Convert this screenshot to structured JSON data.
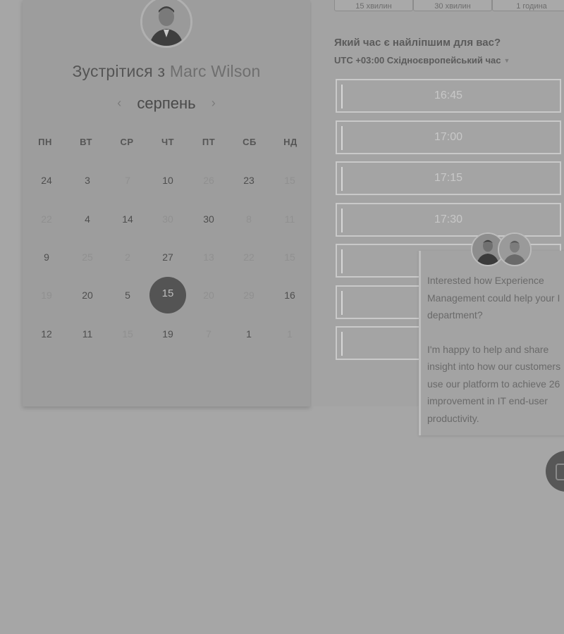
{
  "booking": {
    "title_prefix": "Зустрітися з",
    "host_name": "Marc Wilson",
    "month": "серпень",
    "prev_icon": "chevron-left-icon",
    "next_icon": "chevron-right-icon",
    "weekdays": [
      "ПН",
      "ВТ",
      "СР",
      "ЧТ",
      "ПТ",
      "СБ",
      "НД"
    ],
    "weeks": [
      [
        {
          "d": "24",
          "a": true
        },
        {
          "d": "3",
          "a": true
        },
        {
          "d": "7",
          "a": false
        },
        {
          "d": "10",
          "a": true
        },
        {
          "d": "26",
          "a": false
        },
        {
          "d": "23",
          "a": true
        },
        {
          "d": "15",
          "a": false
        }
      ],
      [
        {
          "d": "22",
          "a": false
        },
        {
          "d": "4",
          "a": true
        },
        {
          "d": "14",
          "a": true
        },
        {
          "d": "30",
          "a": false
        },
        {
          "d": "30",
          "a": true
        },
        {
          "d": "8",
          "a": false
        },
        {
          "d": "11",
          "a": false
        }
      ],
      [
        {
          "d": "9",
          "a": true
        },
        {
          "d": "25",
          "a": false
        },
        {
          "d": "2",
          "a": false
        },
        {
          "d": "27",
          "a": true
        },
        {
          "d": "13",
          "a": false
        },
        {
          "d": "22",
          "a": false
        },
        {
          "d": "15",
          "a": false
        }
      ],
      [
        {
          "d": "19",
          "a": false
        },
        {
          "d": "20",
          "a": true
        },
        {
          "d": "5",
          "a": true
        },
        {
          "d": "15",
          "a": true,
          "selected": true
        },
        {
          "d": "20",
          "a": false
        },
        {
          "d": "29",
          "a": false
        },
        {
          "d": "16",
          "a": true
        }
      ],
      [
        {
          "d": "12",
          "a": true
        },
        {
          "d": "11",
          "a": true
        },
        {
          "d": "15",
          "a": false
        },
        {
          "d": "19",
          "a": true
        },
        {
          "d": "7",
          "a": false
        },
        {
          "d": "1",
          "a": true
        },
        {
          "d": "1",
          "a": false
        }
      ]
    ]
  },
  "duration_tabs": [
    {
      "label": "15 хвилин"
    },
    {
      "label": "30 хвилин"
    },
    {
      "label": "1 година"
    }
  ],
  "time_panel": {
    "question": "Який час є найліпшим для вас?",
    "timezone": "UTC +03:00 Східноєвропейський час",
    "timezone_caret_icon": "caret-down-icon",
    "slots": [
      "16:45",
      "17:00",
      "17:15",
      "17:30",
      "",
      "",
      ""
    ]
  },
  "chat": {
    "message_1": [
      "Interested how Experience",
      "Management could help your I",
      "department?"
    ],
    "message_2": [
      "I'm happy to help and share",
      "insight into how our customers",
      "use our platform to achieve 26",
      "improvement in IT end-user",
      "productivity."
    ],
    "launcher_icon": "chat-icon"
  },
  "colors": {
    "selected_day": "#545454",
    "page_background": "#a6a6a6"
  }
}
